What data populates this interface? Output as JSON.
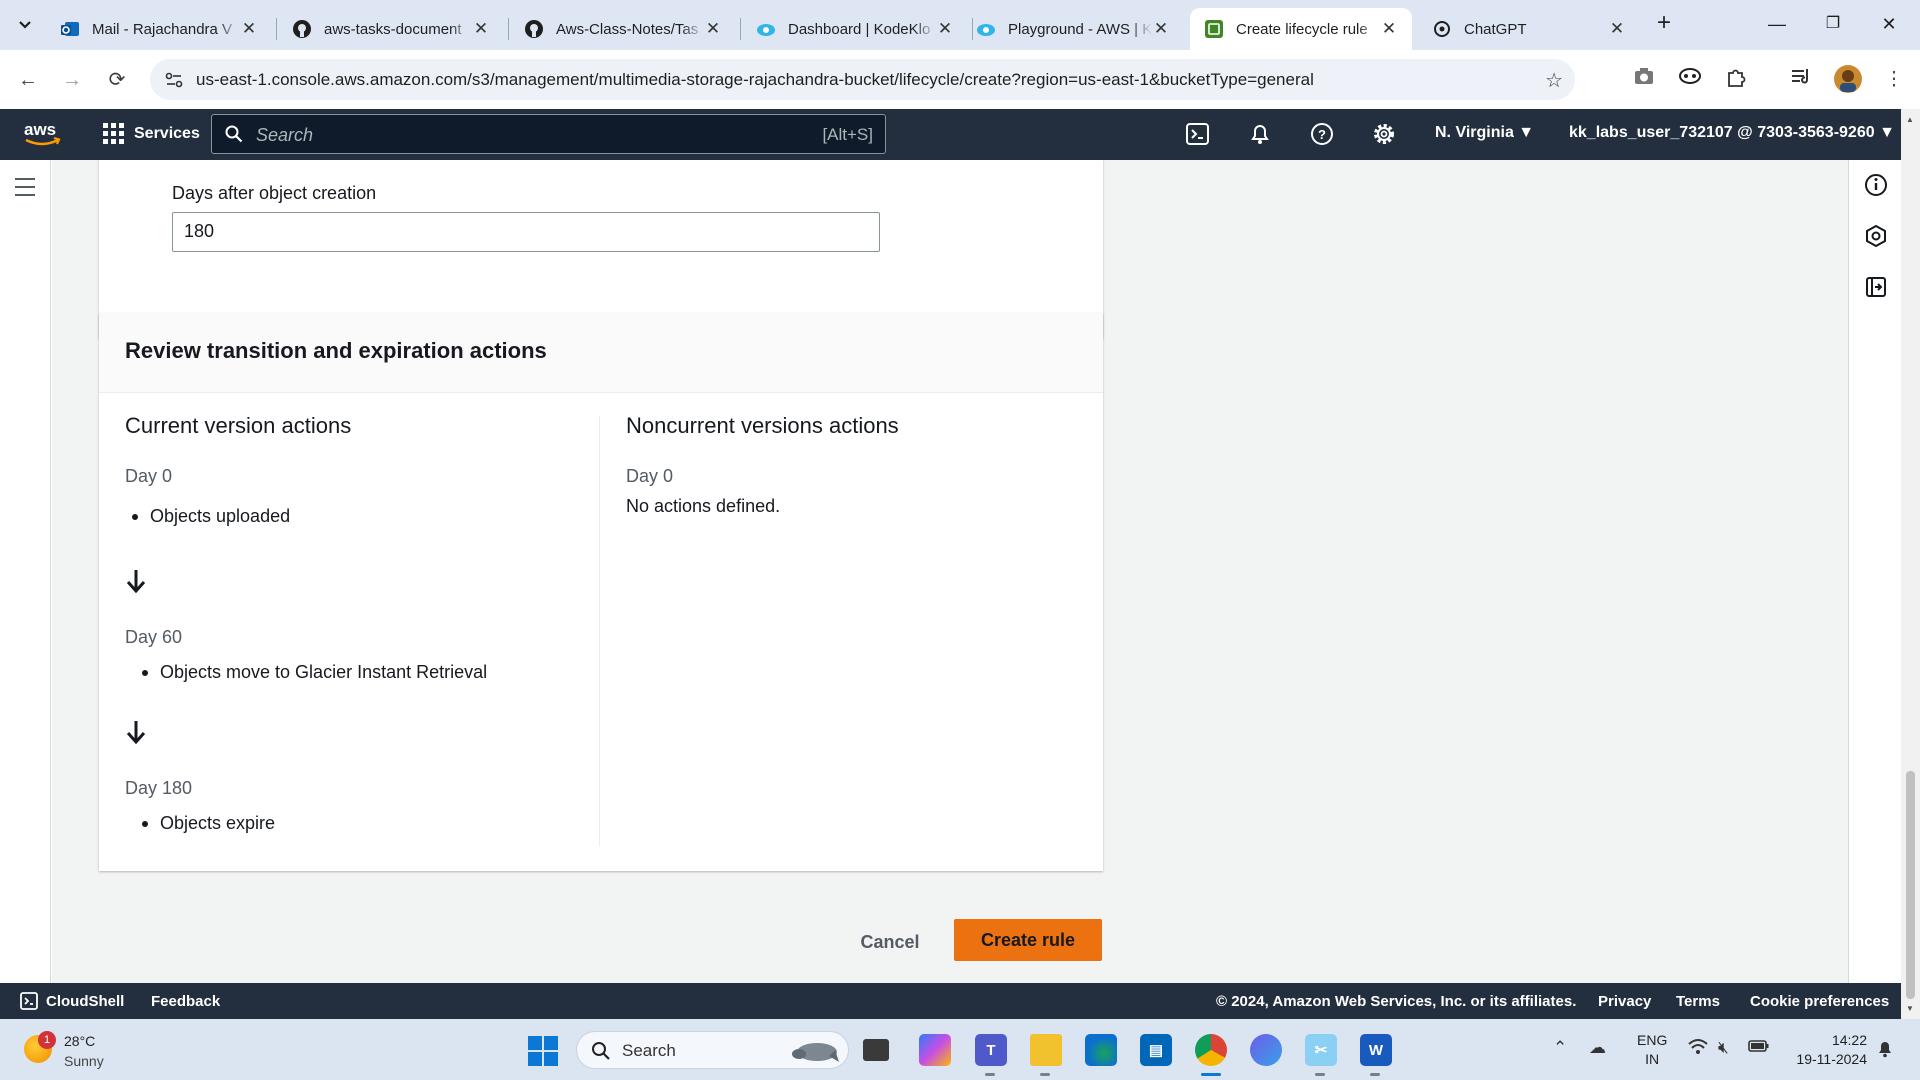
{
  "browser": {
    "tabs": [
      {
        "title": "Mail - Rajachandra V",
        "icon": "outlook-icon"
      },
      {
        "title": "aws-tasks-document",
        "icon": "github-icon"
      },
      {
        "title": "Aws-Class-Notes/Tas",
        "icon": "github-icon"
      },
      {
        "title": "Dashboard | KodeKlo",
        "icon": "kodekloud-icon"
      },
      {
        "title": "Playground - AWS | K",
        "icon": "kodekloud-icon"
      },
      {
        "title": "Create lifecycle rule",
        "icon": "aws-s3-icon"
      },
      {
        "title": "ChatGPT",
        "icon": "chatgpt-icon"
      }
    ],
    "active_tab": 5,
    "url": "us-east-1.console.aws.amazon.com/s3/management/multimedia-storage-rajachandra-bucket/lifecycle/create?region=us-east-1&bucketType=general"
  },
  "aws": {
    "services_label": "Services",
    "search_placeholder": "Search",
    "search_shortcut": "[Alt+S]",
    "region": "N. Virginia",
    "account": "kk_labs_user_732107 @ 7303-3563-9260"
  },
  "form": {
    "days_label": "Days after object creation",
    "days_value": "180"
  },
  "review": {
    "title": "Review transition and expiration actions",
    "current": {
      "title": "Current version actions",
      "steps": [
        {
          "day": "Day 0",
          "action": "Objects uploaded"
        },
        {
          "day": "Day 60",
          "action": "Objects move to Glacier Instant Retrieval"
        },
        {
          "day": "Day 180",
          "action": "Objects expire"
        }
      ]
    },
    "noncurrent": {
      "title": "Noncurrent versions actions",
      "day": "Day 0",
      "text": "No actions defined."
    }
  },
  "actions": {
    "cancel": "Cancel",
    "create": "Create rule"
  },
  "footer": {
    "cloudshell": "CloudShell",
    "feedback": "Feedback",
    "copyright": "© 2024, Amazon Web Services, Inc. or its affiliates.",
    "privacy": "Privacy",
    "terms": "Terms",
    "cookies": "Cookie preferences"
  },
  "taskbar": {
    "weather_badge": "1",
    "temperature": "28°C",
    "condition": "Sunny",
    "search_placeholder": "Search",
    "lang_1": "ENG",
    "lang_2": "IN",
    "time": "14:22",
    "date": "19-11-2024"
  },
  "colors": {
    "aws_nav": "#232f3e",
    "primary_button": "#ec7211",
    "console_bg": "#f2f3f3"
  }
}
